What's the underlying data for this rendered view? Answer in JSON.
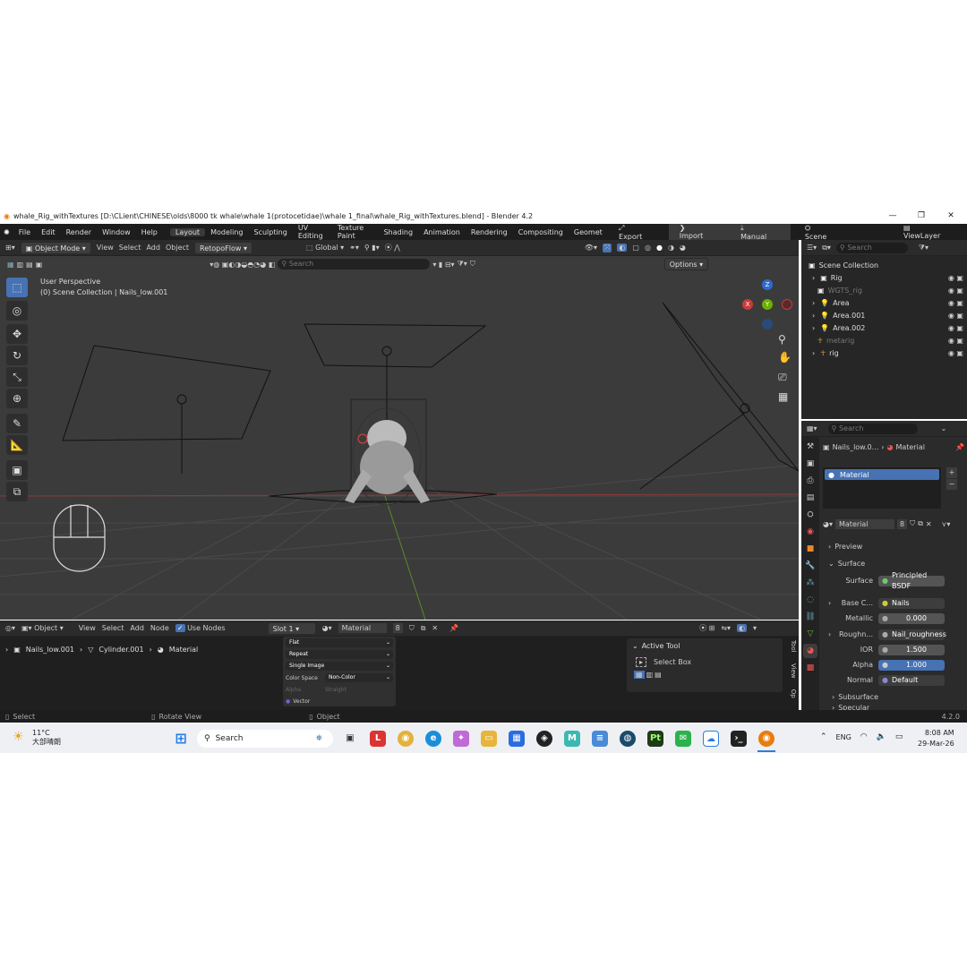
{
  "titlebar": {
    "title": "whale_Rig_withTextures [D:\\CLient\\CHINESE\\olds\\8000 tk whale\\whale 1(protocetidae)\\whale 1_final\\whale_Rig_withTextures.blend] - Blender 4.2"
  },
  "menu": {
    "file": "File",
    "edit": "Edit",
    "render": "Render",
    "window": "Window",
    "help": "Help"
  },
  "workspaces": [
    "Layout",
    "Modeling",
    "Sculpting",
    "UV Editing",
    "Texture Paint",
    "Shading",
    "Animation",
    "Rendering",
    "Compositing",
    "Geometry N"
  ],
  "topright": {
    "export": "Export",
    "import": "Import",
    "manual": "Manual",
    "scene": "Scene",
    "viewlayer": "ViewLayer"
  },
  "viewport": {
    "mode": "Object Mode",
    "view": "View",
    "select": "Select",
    "add": "Add",
    "object": "Object",
    "addon": "RetopoFlow",
    "orientation": "Global",
    "options": "Options",
    "search_placeholder": "Search",
    "perspective": "User Perspective",
    "collection_info": "(0) Scene Collection | Nails_low.001",
    "axis_x": "X",
    "axis_y": "Y",
    "axis_z": "Z"
  },
  "outliner": {
    "search_placeholder": "Search",
    "root": "Scene Collection",
    "items": [
      {
        "label": "Rig",
        "icon": "collection-icon",
        "dim": false
      },
      {
        "label": "WGTS_rig",
        "icon": "collection-icon",
        "dim": true
      },
      {
        "label": "Area",
        "icon": "light-icon",
        "dim": false
      },
      {
        "label": "Area.001",
        "icon": "light-icon",
        "dim": false
      },
      {
        "label": "Area.002",
        "icon": "light-icon",
        "dim": false
      },
      {
        "label": "metarig",
        "icon": "armature-icon",
        "dim": true
      },
      {
        "label": "rig",
        "icon": "armature-icon",
        "dim": false
      }
    ]
  },
  "properties": {
    "search_placeholder": "Search",
    "breadcrumb_object": "Nails_low.0...",
    "breadcrumb_material": "Material",
    "slot_name": "Material",
    "material_name": "Material",
    "user_count": "8",
    "preview_label": "Preview",
    "surface_section": "Surface",
    "surface_label": "Surface",
    "surface_value": "Principled BSDF",
    "basecolor_label": "Base C...",
    "basecolor_value": "Nails",
    "metallic_label": "Metallic",
    "metallic_value": "0.000",
    "roughness_label": "Roughn...",
    "roughness_value": "Nail_roughness",
    "ior_label": "IOR",
    "ior_value": "1.500",
    "alpha_label": "Alpha",
    "alpha_value": "1.000",
    "normal_label": "Normal",
    "normal_value": "Default",
    "subsurface_label": "Subsurface",
    "specular_label": "Specular"
  },
  "nodeeditor": {
    "type": "Object",
    "view": "View",
    "select": "Select",
    "add": "Add",
    "node": "Node",
    "use_nodes": "Use Nodes",
    "slot": "Slot 1",
    "material": "Material",
    "user_count": "8",
    "breadcrumb": [
      "Nails_low.001",
      "Cylinder.001",
      "Material"
    ],
    "tex_node": {
      "interp": "Flat",
      "extension": "Repeat",
      "source": "Single Image",
      "colorspace_label": "Color Space",
      "colorspace_value": "Non-Color",
      "alpha_label": "Alpha",
      "alpha_value": "Straight",
      "vector": "Vector"
    },
    "active_tool_title": "Active Tool",
    "active_tool_value": "Select Box",
    "side_tabs": [
      "Tool",
      "View",
      "Op"
    ]
  },
  "statusbar": {
    "select": "Select",
    "rotate": "Rotate View",
    "object": "Object",
    "version": "4.2.0"
  },
  "taskbar": {
    "temp": "11°C",
    "weather": "大部晴朗",
    "search": "Search",
    "lang": "ENG",
    "time": "8:08 AM",
    "date": "29-Mar-26"
  },
  "colors": {
    "accent": "#4772b3",
    "viewport_bg": "#3b3b3b",
    "panel_bg": "#2b2b2b"
  }
}
